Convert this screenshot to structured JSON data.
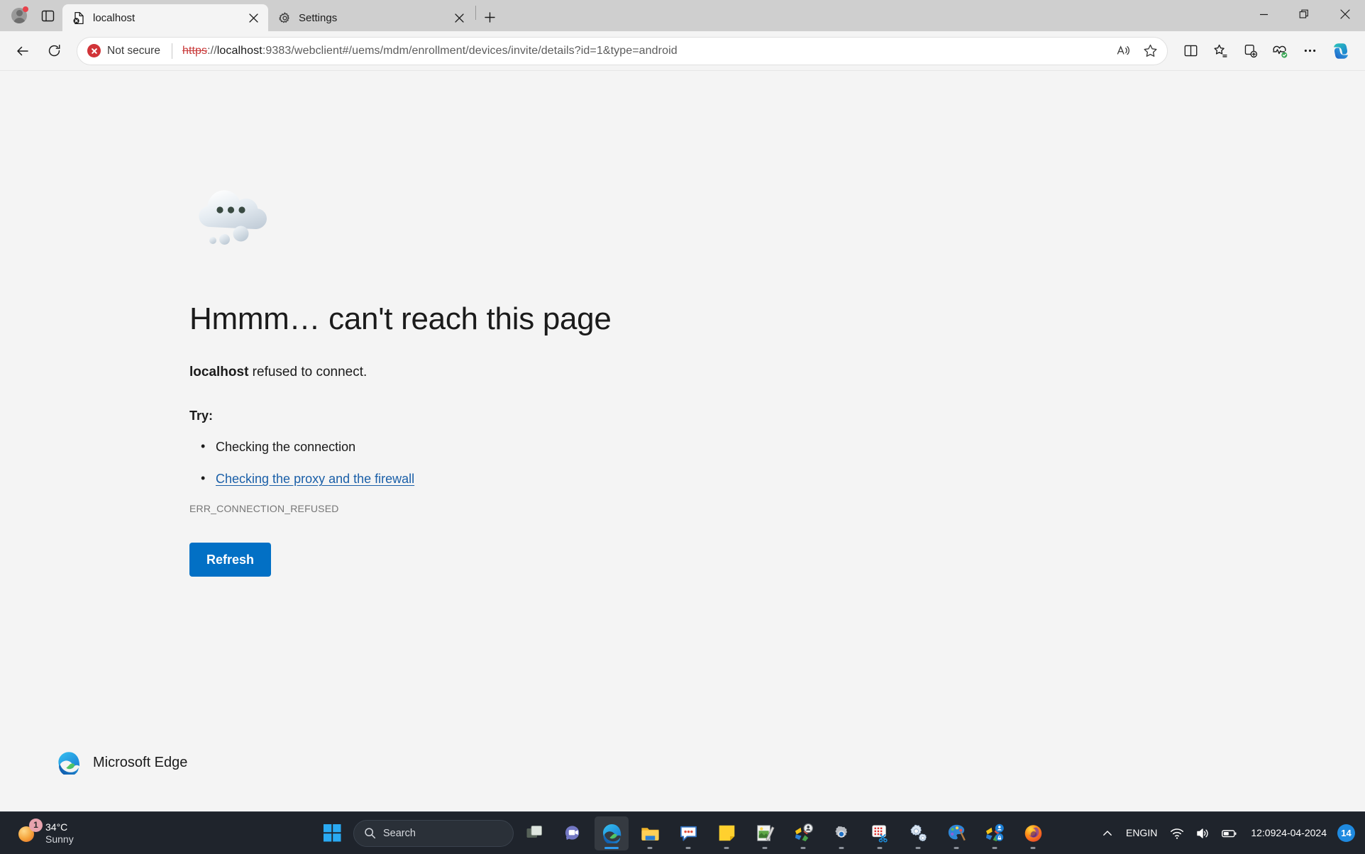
{
  "browser": {
    "name": "Microsoft Edge",
    "tabs": [
      {
        "title": "localhost",
        "favicon": "error-page-icon",
        "active": true,
        "close_label": "×"
      },
      {
        "title": "Settings",
        "favicon": "gear-icon",
        "active": false,
        "close_label": "×"
      }
    ],
    "newtab_label": "+",
    "window_controls": {
      "minimize": "—",
      "restore": "❐",
      "close": "✕"
    },
    "toolbar": {
      "back_label": "←",
      "refresh_label": "⟳",
      "security_label": "Not secure",
      "security_icon": "not-secure-icon",
      "read_aloud_label": "Read aloud",
      "favorite_label": "Add this page to favorites",
      "split_screen_label": "Split screen",
      "favorites_label": "Favorites",
      "collections_label": "Collections",
      "essentials_label": "Browser essentials",
      "more_label": "•••",
      "copilot_label": "Copilot"
    },
    "address": {
      "scheme": "https",
      "separator": "://",
      "host": "localhost",
      "rest": ":9383/webclient#/uems/mdm/enrollment/devices/invite/details?id=1&type=android",
      "full": "https://localhost:9383/webclient#/uems/mdm/enrollment/devices/invite/details?id=1&type=android"
    }
  },
  "error_page": {
    "illustration": "cloud-with-dots-icon",
    "title": "Hmmm… can't reach this page",
    "subject": "localhost",
    "subject_rest": " refused to connect.",
    "try_label": "Try:",
    "suggestions": [
      {
        "text": "Checking the connection",
        "link": false
      },
      {
        "text": "Checking the proxy and the firewall",
        "link": true
      }
    ],
    "error_code": "ERR_CONNECTION_REFUSED",
    "refresh_label": "Refresh",
    "footer_brand": "Microsoft Edge"
  },
  "taskbar": {
    "weather": {
      "temperature": "34°C",
      "condition": "Sunny",
      "badge": "1",
      "icon": "sun-icon"
    },
    "start_label": "Start",
    "search_placeholder": "Search",
    "search_icon": "search-icon",
    "taskview_label": "Task view",
    "apps": [
      {
        "name": "chat-app",
        "label": "Chat",
        "active": false,
        "running": false
      },
      {
        "name": "microsoft-edge",
        "label": "Microsoft Edge",
        "active": true,
        "running": true
      },
      {
        "name": "file-explorer",
        "label": "File Explorer",
        "active": false,
        "running": true
      },
      {
        "name": "messaging-app",
        "label": "Messaging",
        "active": false,
        "running": true
      },
      {
        "name": "sticky-notes",
        "label": "Sticky Notes",
        "active": false,
        "running": true
      },
      {
        "name": "paint-legacy",
        "label": "Paint",
        "active": false,
        "running": true
      },
      {
        "name": "pinwheel-app-one",
        "label": "App",
        "active": false,
        "running": true
      },
      {
        "name": "settings-gear-app",
        "label": "Settings",
        "active": false,
        "running": true
      },
      {
        "name": "snipping-tool",
        "label": "Snipping Tool",
        "active": false,
        "running": true
      },
      {
        "name": "settings-app",
        "label": "Settings",
        "active": false,
        "running": true
      },
      {
        "name": "paint-palette-app",
        "label": "Paint",
        "active": false,
        "running": true
      },
      {
        "name": "pinwheel-app-two",
        "label": "App",
        "active": false,
        "running": true
      },
      {
        "name": "mozilla-firefox",
        "label": "Firefox",
        "active": false,
        "running": true
      }
    ],
    "tray": {
      "overflow_label": "⌃",
      "language_primary": "ENG",
      "language_secondary": "IN",
      "wifi_label": "Network",
      "volume_label": "Volume",
      "battery_label": "Battery",
      "time": "12:09",
      "date": "24-04-2024",
      "notification_count": "14"
    }
  },
  "colors": {
    "accent_blue": "#0270c5",
    "link_blue": "#1a5fa8",
    "page_bg": "#f4f4f4",
    "tabstrip_bg": "#cfcfcf",
    "taskbar_bg": "#1f242c",
    "error_red": "#d13438",
    "notification_blue": "#1f8ae0"
  }
}
